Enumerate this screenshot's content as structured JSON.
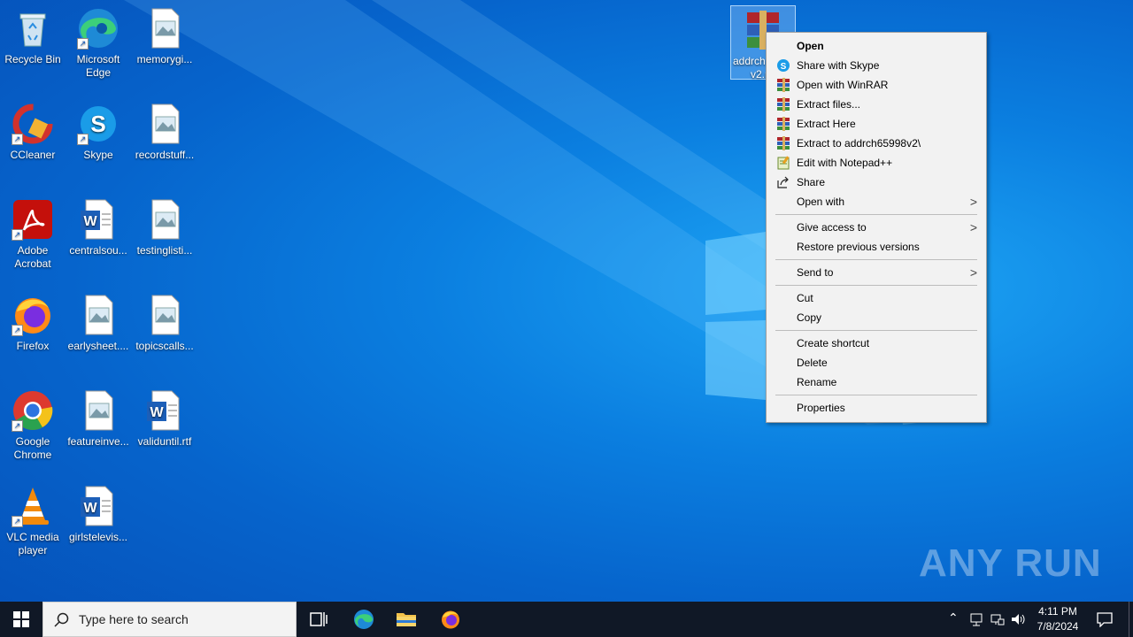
{
  "desktop": {
    "icons": [
      {
        "label": "Recycle Bin"
      },
      {
        "label": "Microsoft Edge"
      },
      {
        "label": "memorygi..."
      },
      {
        "label": "CCleaner"
      },
      {
        "label": "Skype"
      },
      {
        "label": "recordstuff..."
      },
      {
        "label": "Adobe Acrobat"
      },
      {
        "label": "centralsou..."
      },
      {
        "label": "testinglisti..."
      },
      {
        "label": "Firefox"
      },
      {
        "label": "earlysheet...."
      },
      {
        "label": "topicscalls..."
      },
      {
        "label": "Google Chrome"
      },
      {
        "label": "featureinve..."
      },
      {
        "label": "validuntil.rtf"
      },
      {
        "label": "VLC media player"
      },
      {
        "label": "girlstelevis..."
      }
    ],
    "selected_file": {
      "label_line1": "addrch",
      "label_line2": "v2.r"
    }
  },
  "context_menu": {
    "items": [
      {
        "label": "Open"
      },
      {
        "label": "Share with Skype"
      },
      {
        "label": "Open with WinRAR"
      },
      {
        "label": "Extract files..."
      },
      {
        "label": "Extract Here"
      },
      {
        "label": "Extract to addrch65998v2\\"
      },
      {
        "label": "Edit with Notepad++"
      },
      {
        "label": "Share"
      },
      {
        "label": "Open with"
      },
      {
        "label": "Give access to"
      },
      {
        "label": "Restore previous versions"
      },
      {
        "label": "Send to"
      },
      {
        "label": "Cut"
      },
      {
        "label": "Copy"
      },
      {
        "label": "Create shortcut"
      },
      {
        "label": "Delete"
      },
      {
        "label": "Rename"
      },
      {
        "label": "Properties"
      }
    ]
  },
  "taskbar": {
    "search_placeholder": "Type here to search",
    "time": "4:11 PM",
    "date": "7/8/2024"
  },
  "watermark": "ANY RUN"
}
